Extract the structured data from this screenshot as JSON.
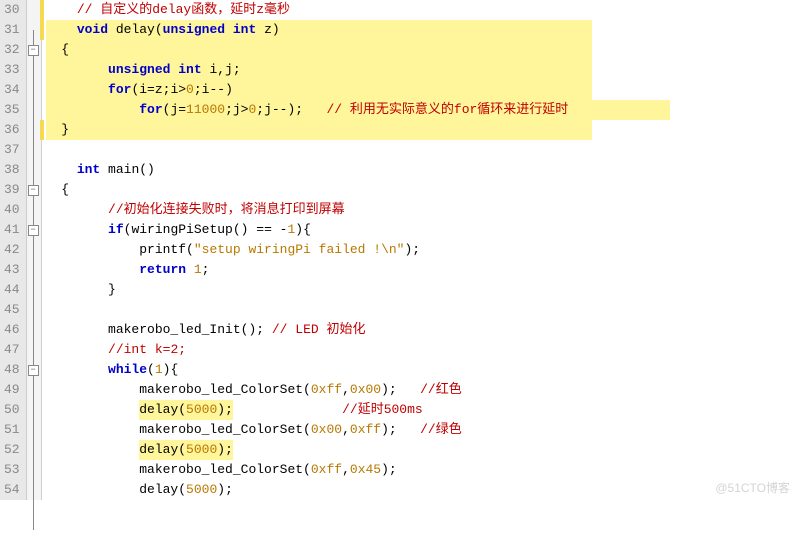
{
  "watermark": "@51CTO博客",
  "lines": [
    {
      "n": 30,
      "marker": true,
      "hl": false,
      "segs": [
        {
          "t": "    ",
          "c": ""
        },
        {
          "t": "// 自定义的delay函数，延时z毫秒",
          "c": "cm"
        }
      ]
    },
    {
      "n": 31,
      "marker": true,
      "hl": true,
      "segs": [
        {
          "t": "    ",
          "c": ""
        },
        {
          "t": "void",
          "c": "kw"
        },
        {
          "t": " delay(",
          "c": ""
        },
        {
          "t": "unsigned int",
          "c": "kw"
        },
        {
          "t": " z)",
          "c": ""
        }
      ]
    },
    {
      "n": 32,
      "marker": false,
      "hl": true,
      "fold": "minus",
      "segs": [
        {
          "t": "  {",
          "c": ""
        }
      ]
    },
    {
      "n": 33,
      "marker": false,
      "hl": true,
      "segs": [
        {
          "t": "        ",
          "c": ""
        },
        {
          "t": "unsigned int",
          "c": "kw"
        },
        {
          "t": " i,j;",
          "c": ""
        }
      ]
    },
    {
      "n": 34,
      "marker": false,
      "hl": true,
      "segs": [
        {
          "t": "        ",
          "c": ""
        },
        {
          "t": "for",
          "c": "kw"
        },
        {
          "t": "(i=z;i>",
          "c": ""
        },
        {
          "t": "0",
          "c": "num"
        },
        {
          "t": ";i--)",
          "c": ""
        }
      ]
    },
    {
      "n": 35,
      "marker": false,
      "hl": true,
      "segs": [
        {
          "t": "            ",
          "c": ""
        },
        {
          "t": "for",
          "c": "kw"
        },
        {
          "t": "(j=",
          "c": ""
        },
        {
          "t": "11000",
          "c": "num"
        },
        {
          "t": ";j>",
          "c": ""
        },
        {
          "t": "0",
          "c": "num"
        },
        {
          "t": ";j--);   ",
          "c": ""
        },
        {
          "t": "// 利用无实际意义的for循环来进行延时",
          "c": "cm"
        }
      ]
    },
    {
      "n": 36,
      "marker": true,
      "hl": true,
      "segs": [
        {
          "t": "  }",
          "c": ""
        }
      ]
    },
    {
      "n": 37,
      "marker": false,
      "hl": false,
      "segs": [
        {
          "t": "",
          "c": ""
        }
      ]
    },
    {
      "n": 38,
      "marker": false,
      "hl": false,
      "segs": [
        {
          "t": "    ",
          "c": ""
        },
        {
          "t": "int",
          "c": "kw"
        },
        {
          "t": " main()",
          "c": ""
        }
      ]
    },
    {
      "n": 39,
      "marker": false,
      "hl": false,
      "fold": "minus",
      "segs": [
        {
          "t": "  {",
          "c": ""
        }
      ]
    },
    {
      "n": 40,
      "marker": false,
      "hl": false,
      "segs": [
        {
          "t": "        ",
          "c": ""
        },
        {
          "t": "//初始化连接失败时，将消息打印到屏幕",
          "c": "cm"
        }
      ]
    },
    {
      "n": 41,
      "marker": false,
      "hl": false,
      "fold": "minus",
      "segs": [
        {
          "t": "        ",
          "c": ""
        },
        {
          "t": "if",
          "c": "kw"
        },
        {
          "t": "(wiringPiSetup() == -",
          "c": ""
        },
        {
          "t": "1",
          "c": "num"
        },
        {
          "t": "){",
          "c": ""
        }
      ]
    },
    {
      "n": 42,
      "marker": false,
      "hl": false,
      "segs": [
        {
          "t": "            printf(",
          "c": ""
        },
        {
          "t": "\"setup wiringPi failed !\\n\"",
          "c": "str"
        },
        {
          "t": ");",
          "c": ""
        }
      ]
    },
    {
      "n": 43,
      "marker": false,
      "hl": false,
      "segs": [
        {
          "t": "            ",
          "c": ""
        },
        {
          "t": "return",
          "c": "kw"
        },
        {
          "t": " ",
          "c": ""
        },
        {
          "t": "1",
          "c": "num"
        },
        {
          "t": ";",
          "c": ""
        }
      ]
    },
    {
      "n": 44,
      "marker": false,
      "hl": false,
      "segs": [
        {
          "t": "        }",
          "c": ""
        }
      ]
    },
    {
      "n": 45,
      "marker": false,
      "hl": false,
      "segs": [
        {
          "t": "",
          "c": ""
        }
      ]
    },
    {
      "n": 46,
      "marker": false,
      "hl": false,
      "segs": [
        {
          "t": "        makerobo_led_Init(); ",
          "c": ""
        },
        {
          "t": "// LED 初始化",
          "c": "cm"
        }
      ]
    },
    {
      "n": 47,
      "marker": false,
      "hl": false,
      "segs": [
        {
          "t": "        ",
          "c": ""
        },
        {
          "t": "//int k=2;",
          "c": "cm"
        }
      ]
    },
    {
      "n": 48,
      "marker": false,
      "hl": false,
      "fold": "minus",
      "segs": [
        {
          "t": "        ",
          "c": ""
        },
        {
          "t": "while",
          "c": "kw"
        },
        {
          "t": "(",
          "c": ""
        },
        {
          "t": "1",
          "c": "num"
        },
        {
          "t": "){",
          "c": ""
        }
      ]
    },
    {
      "n": 49,
      "marker": false,
      "hl": false,
      "segs": [
        {
          "t": "            makerobo_led_ColorSet(",
          "c": ""
        },
        {
          "t": "0xff",
          "c": "hex"
        },
        {
          "t": ",",
          "c": ""
        },
        {
          "t": "0x00",
          "c": "hex"
        },
        {
          "t": ");   ",
          "c": ""
        },
        {
          "t": "//红色",
          "c": "cm"
        }
      ]
    },
    {
      "n": 50,
      "marker": false,
      "hl": false,
      "hlspan": true,
      "segs": [
        {
          "t": "            ",
          "c": ""
        },
        {
          "t": "delay(",
          "c": ""
        },
        {
          "t": "5000",
          "c": "num"
        },
        {
          "t": ");",
          "c": ""
        },
        {
          "t": "              ",
          "c": "",
          "nohl": true
        },
        {
          "t": "//延时500ms",
          "c": "cm",
          "nohl": true
        }
      ]
    },
    {
      "n": 51,
      "marker": false,
      "hl": false,
      "segs": [
        {
          "t": "            makerobo_led_ColorSet(",
          "c": ""
        },
        {
          "t": "0x00",
          "c": "hex"
        },
        {
          "t": ",",
          "c": ""
        },
        {
          "t": "0xff",
          "c": "hex"
        },
        {
          "t": ");   ",
          "c": ""
        },
        {
          "t": "//绿色",
          "c": "cm"
        }
      ]
    },
    {
      "n": 52,
      "marker": false,
      "hl": false,
      "hlspan": true,
      "segs": [
        {
          "t": "            ",
          "c": ""
        },
        {
          "t": "delay(",
          "c": ""
        },
        {
          "t": "5000",
          "c": "num"
        },
        {
          "t": ");",
          "c": ""
        }
      ]
    },
    {
      "n": 53,
      "marker": false,
      "hl": false,
      "segs": [
        {
          "t": "            makerobo_led_ColorSet(",
          "c": ""
        },
        {
          "t": "0xff",
          "c": "hex"
        },
        {
          "t": ",",
          "c": ""
        },
        {
          "t": "0x45",
          "c": "hex"
        },
        {
          "t": ");",
          "c": ""
        }
      ]
    },
    {
      "n": 54,
      "marker": false,
      "hl": false,
      "segs": [
        {
          "t": "            delay(",
          "c": ""
        },
        {
          "t": "5000",
          "c": "num"
        },
        {
          "t": ");",
          "c": ""
        }
      ]
    }
  ]
}
